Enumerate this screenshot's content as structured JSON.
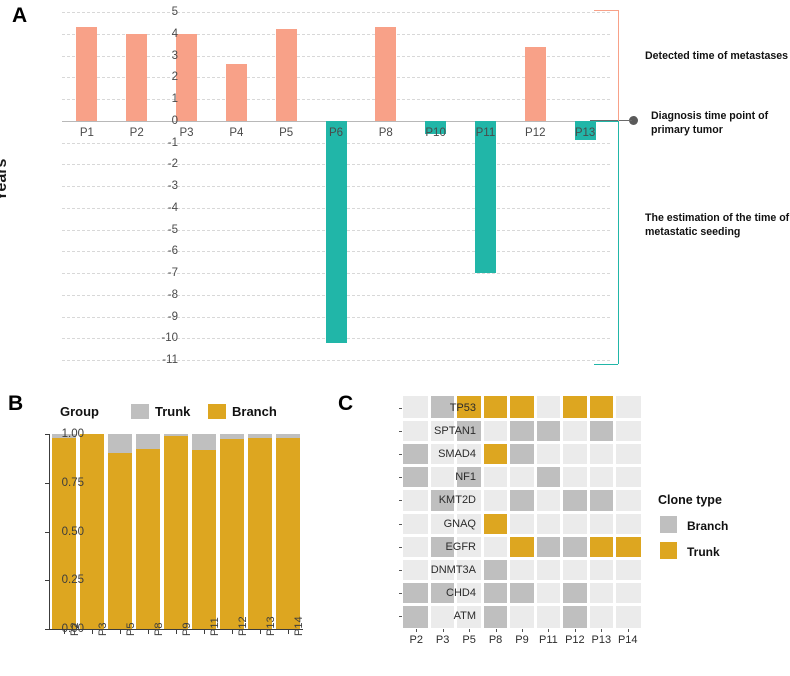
{
  "figure": {
    "panels": [
      {
        "letter": "A"
      },
      {
        "letter": "B"
      },
      {
        "letter": "C"
      }
    ]
  },
  "colors": {
    "salmon": "#F8A188",
    "teal": "#21B6A8",
    "gold": "#DDA620",
    "gray": "#BFBFBF",
    "panelC_background": "#EBEBEB",
    "gridline": "#D8D8D8",
    "dot": "#5A5A5A"
  },
  "panelA": {
    "letter": "A",
    "ylabel": "Years",
    "yticks": [
      "5",
      "4",
      "3",
      "2",
      "1",
      "0",
      "-1",
      "-2",
      "-3",
      "-4",
      "-5",
      "-6",
      "-7",
      "-8",
      "-9",
      "-10",
      "-11"
    ],
    "annotations": {
      "top": "Detected time of metastases",
      "middle": "Diagnosis time point of primary tumor",
      "bottom": "The estimation of the time of metastatic seeding"
    },
    "chart_data": {
      "type": "bar",
      "title": "",
      "xlabel": "",
      "ylabel": "Years",
      "ylim": [
        -11,
        5
      ],
      "grid": true,
      "categories": [
        "P1",
        "P2",
        "P3",
        "P4",
        "P5",
        "P6",
        "P8",
        "P10",
        "P11",
        "P12",
        "P13"
      ],
      "values": [
        4.3,
        4.0,
        4.0,
        2.6,
        4.2,
        -10.2,
        4.3,
        -0.6,
        -7.0,
        3.4,
        -0.9
      ],
      "bar_colors": [
        "#F8A188",
        "#F8A188",
        "#F8A188",
        "#F8A188",
        "#F8A188",
        "#21B6A8",
        "#F8A188",
        "#21B6A8",
        "#21B6A8",
        "#F8A188",
        "#21B6A8"
      ]
    }
  },
  "panelB": {
    "letter": "B",
    "legend_title": "Group",
    "legend_items": [
      {
        "label": "Trunk",
        "color": "#BFBFBF"
      },
      {
        "label": "Branch",
        "color": "#DDA620"
      }
    ],
    "chart_data": {
      "type": "bar",
      "stacked": true,
      "title": "",
      "xlabel": "",
      "ylabel": "",
      "ylim": [
        0,
        1
      ],
      "yticks": [
        "0.00",
        "0.25",
        "0.50",
        "0.75",
        "1.00"
      ],
      "categories": [
        "P2",
        "P3",
        "P5",
        "P8",
        "P9",
        "P11",
        "P12",
        "P13",
        "P14"
      ],
      "series": [
        {
          "name": "Branch",
          "color": "#DDA620",
          "values": [
            0.978,
            1.0,
            0.905,
            0.925,
            0.99,
            0.918,
            0.975,
            0.982,
            0.978
          ]
        },
        {
          "name": "Trunk",
          "color": "#BFBFBF",
          "values": [
            0.022,
            0.0,
            0.095,
            0.075,
            0.01,
            0.082,
            0.025,
            0.018,
            0.022
          ]
        }
      ]
    }
  },
  "panelC": {
    "letter": "C",
    "legend_title": "Clone type",
    "legend_items": [
      {
        "label": "Branch",
        "color": "#BFBFBF"
      },
      {
        "label": "Trunk",
        "color": "#DDA620"
      }
    ],
    "chart_data": {
      "type": "heatmap",
      "title": "",
      "xlabel": "",
      "ylabel": "",
      "columns": [
        "P2",
        "P3",
        "P5",
        "P8",
        "P9",
        "P11",
        "P12",
        "P13",
        "P14"
      ],
      "rows": [
        "TP53",
        "SPTAN1",
        "SMAD4",
        "NF1",
        "KMT2D",
        "GNAQ",
        "EGFR",
        "DNMT3A",
        "CHD4",
        "ATM"
      ],
      "legend": [
        "Branch",
        "Trunk"
      ],
      "cells": [
        [
          "none",
          "Branch",
          "Trunk",
          "Trunk",
          "Trunk",
          "none",
          "Trunk",
          "Trunk",
          "none"
        ],
        [
          "none",
          "none",
          "Branch",
          "none",
          "Branch",
          "Branch",
          "none",
          "Branch",
          "none"
        ],
        [
          "Branch",
          "none",
          "none",
          "Trunk",
          "Branch",
          "none",
          "none",
          "none",
          "none"
        ],
        [
          "Branch",
          "none",
          "Branch",
          "none",
          "none",
          "Branch",
          "none",
          "none",
          "none"
        ],
        [
          "none",
          "Branch",
          "none",
          "none",
          "Branch",
          "none",
          "Branch",
          "Branch",
          "none"
        ],
        [
          "none",
          "none",
          "none",
          "Trunk",
          "none",
          "none",
          "none",
          "none",
          "none"
        ],
        [
          "none",
          "Branch",
          "none",
          "none",
          "Trunk",
          "Branch",
          "Branch",
          "Trunk",
          "Trunk"
        ],
        [
          "none",
          "none",
          "none",
          "Branch",
          "none",
          "none",
          "none",
          "none",
          "none"
        ],
        [
          "Branch",
          "Branch",
          "none",
          "Branch",
          "Branch",
          "none",
          "Branch",
          "none",
          "none"
        ],
        [
          "Branch",
          "none",
          "none",
          "Branch",
          "none",
          "none",
          "Branch",
          "none",
          "none"
        ]
      ]
    }
  }
}
